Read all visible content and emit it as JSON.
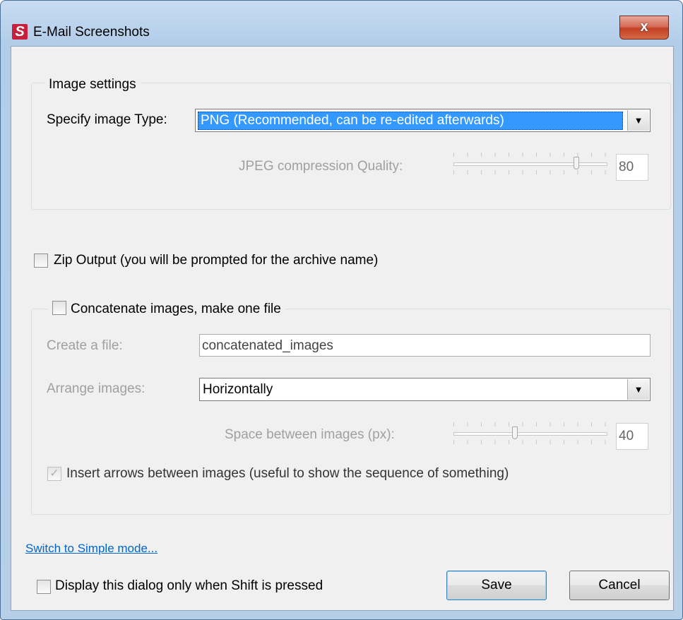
{
  "window": {
    "title": "E-Mail Screenshots",
    "app_icon_letter": "S",
    "close_glyph": "x"
  },
  "image_settings": {
    "legend": "Image settings",
    "type_label": "Specify image Type:",
    "type_value": "PNG   (Recommended, can be re-edited afterwards)",
    "quality_label": "JPEG compression Quality:",
    "quality_value": "80",
    "quality_level": 0.8
  },
  "zip_output": {
    "label": "Zip Output (you will be prompted for the archive name)",
    "checked": false
  },
  "concatenate": {
    "legend": "Concatenate images, make one file",
    "checked": false,
    "file_label": "Create a file:",
    "file_value": "concatenated_images",
    "arrange_label": "Arrange images:",
    "arrange_value": "Horizontally",
    "space_label": "Space between images (px):",
    "space_value": "40",
    "space_level": 0.4,
    "arrows_label": "Insert arrows between images (useful to show the sequence of something)",
    "arrows_checked": true
  },
  "footer": {
    "switch_link": "Switch to Simple mode...",
    "shift_label": "Display this dialog only when Shift is pressed",
    "shift_checked": false,
    "save_label": "Save",
    "cancel_label": "Cancel"
  },
  "icons": {
    "dropdown": "chevron-down-icon",
    "check": "check-icon"
  },
  "colors": {
    "accent": "#3399ff",
    "link": "#0066cc",
    "close_button": "#c24126",
    "app_icon": "#c6203b"
  }
}
